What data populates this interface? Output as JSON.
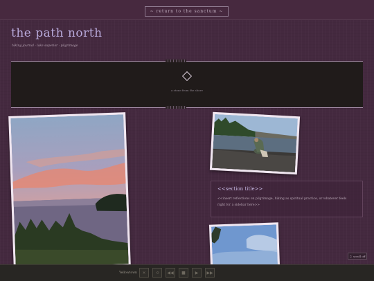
{
  "topbar": {
    "return_label": "~ return to the sanctum ~"
  },
  "header": {
    "title": "the path north",
    "subtitle": "hiking journal · lake superior · pilgrimage"
  },
  "banner": {
    "caption": "a stone from the shore"
  },
  "section": {
    "title": "<<section title>>",
    "text": "<<insert reflections on pilgrimage, hiking as spiritual practice, or whatever feels right for a sidebar here>>"
  },
  "scroll": {
    "label": "scroll off"
  },
  "player": {
    "label": "Yellowtown",
    "controls": [
      "close-icon",
      "rewind-icon",
      "previous-icon",
      "stop-icon",
      "play-icon",
      "next-icon"
    ]
  },
  "colors": {
    "background": "#44293f",
    "accent": "#b8a9da",
    "frame": "#f0e6f0",
    "banner": "#201b1a"
  }
}
